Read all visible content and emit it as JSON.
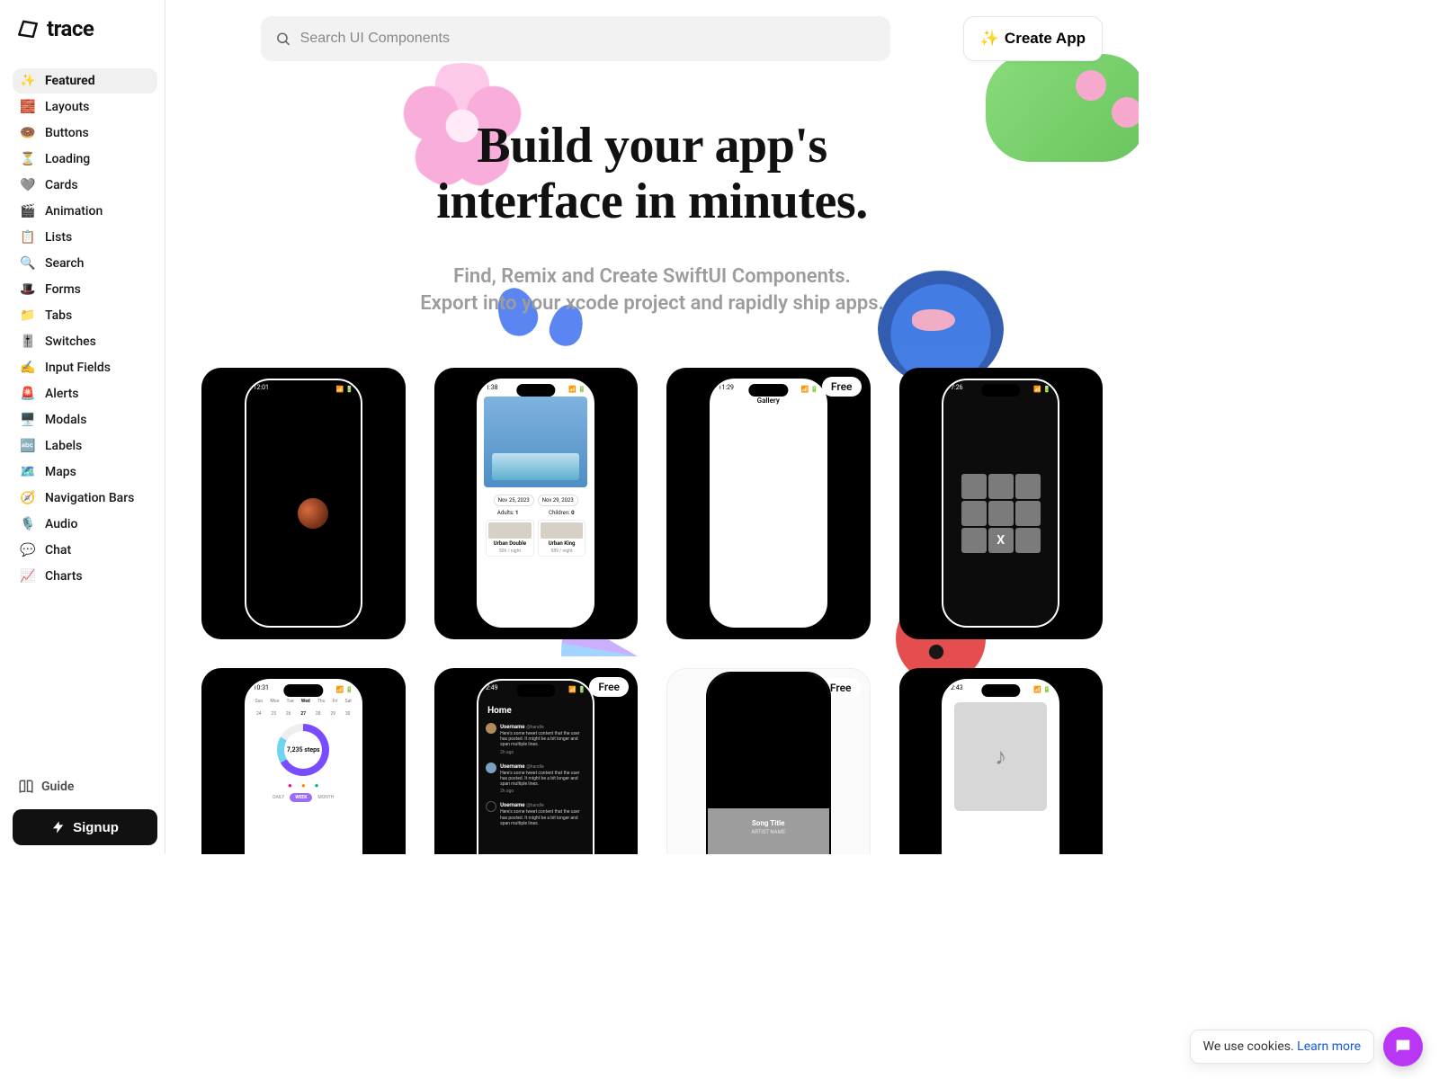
{
  "brand": "trace",
  "sidebar": {
    "items": [
      {
        "icon": "✨",
        "label": "Featured",
        "active": true
      },
      {
        "icon": "🧱",
        "label": "Layouts"
      },
      {
        "icon": "🍩",
        "label": "Buttons"
      },
      {
        "icon": "⏳",
        "label": "Loading"
      },
      {
        "icon": "🩶",
        "label": "Cards"
      },
      {
        "icon": "🎬",
        "label": "Animation"
      },
      {
        "icon": "📋",
        "label": "Lists"
      },
      {
        "icon": "🔍",
        "label": "Search"
      },
      {
        "icon": "🎩",
        "label": "Forms"
      },
      {
        "icon": "📁",
        "label": "Tabs"
      },
      {
        "icon": "🎚️",
        "label": "Switches"
      },
      {
        "icon": "✍️",
        "label": "Input Fields"
      },
      {
        "icon": "🚨",
        "label": "Alerts"
      },
      {
        "icon": "🖥️",
        "label": "Modals"
      },
      {
        "icon": "🔤",
        "label": "Labels"
      },
      {
        "icon": "🗺️",
        "label": "Maps"
      },
      {
        "icon": "🧭",
        "label": "Navigation Bars"
      },
      {
        "icon": "🎙️",
        "label": "Audio"
      },
      {
        "icon": "💬",
        "label": "Chat"
      },
      {
        "icon": "📈",
        "label": "Charts"
      }
    ],
    "guide_label": "Guide",
    "signup_label": "Signup"
  },
  "search": {
    "placeholder": "Search UI Components"
  },
  "create_app": {
    "sparkle": "✨",
    "label": "Create App"
  },
  "hero": {
    "title_l1": "Build your app's",
    "title_l2": "interface in minutes.",
    "sub_l1": "Find, Remix and Create SwiftUI Components.",
    "sub_l2": "Export into your xcode project and rapidly ship apps."
  },
  "badges": {
    "free": "Free"
  },
  "cards": {
    "c1": {
      "time": "12:01"
    },
    "c2": {
      "time": "1:38",
      "date_from": "Nov 25, 2023",
      "date_to": "Nov 29, 2023",
      "adults_label": "Adults:",
      "adults_val": "1",
      "children_label": "Children:",
      "children_val": "0",
      "rooms": [
        {
          "name": "Urban Double",
          "sub": "506 / night"
        },
        {
          "name": "Urban King",
          "sub": "589 / night"
        }
      ]
    },
    "c3": {
      "time": "11:29",
      "title": "Gallery"
    },
    "c4": {
      "time": "7:26",
      "mark": "X"
    },
    "c5": {
      "time": "10:31",
      "days": [
        "Sun",
        "Mon",
        "Tue",
        "Wed",
        "Thu",
        "Fri",
        "Sat"
      ],
      "nums": [
        "24",
        "25",
        "26",
        "27",
        "28",
        "29",
        "30"
      ],
      "steps": "7,235 steps",
      "seg": [
        "DAILY",
        "WEEK",
        "MONTH"
      ]
    },
    "c6": {
      "time": "2:49",
      "heading": "Home",
      "username": "Username",
      "handle": "@handle",
      "body": "Here's some tweet content that the user has posted. It might be a bit longer and span multiple lines.",
      "age": "2h ago"
    },
    "c7": {
      "song": "Song Title",
      "artist": "ARTIST NAME"
    },
    "c8": {
      "time": "2:43"
    }
  },
  "cookie": {
    "text": "We use cookies. ",
    "link": "Learn more"
  }
}
